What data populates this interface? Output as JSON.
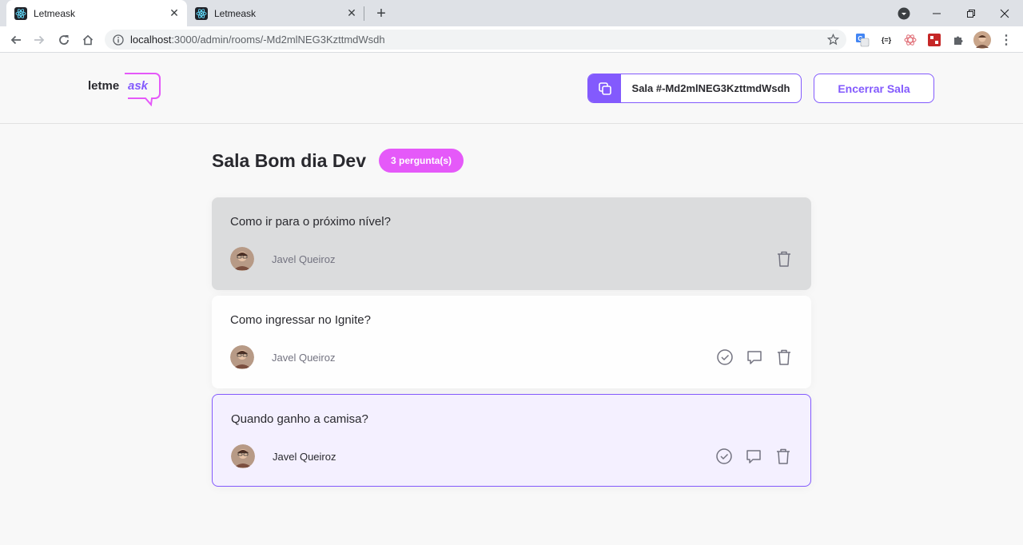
{
  "browser": {
    "tabs": [
      {
        "title": "Letmeask",
        "active": true
      },
      {
        "title": "Letmeask",
        "active": false
      }
    ],
    "url_host": "localhost",
    "url_rest": ":3000/admin/rooms/-Md2mlNEG3KzttmdWsdh"
  },
  "header": {
    "logo_text_primary": "letme",
    "logo_text_accent": "ask",
    "room_code_label": "Sala #-Md2mlNEG3KzttmdWsdh",
    "close_room_label": "Encerrar Sala"
  },
  "room": {
    "title": "Sala Bom dia Dev",
    "question_count": "3 pergunta(s)"
  },
  "questions": [
    {
      "text": "Como ir para o próximo nível?",
      "author": "Javel Queiroz",
      "state": "answered"
    },
    {
      "text": "Como ingressar no Ignite?",
      "author": "Javel Queiroz",
      "state": "default"
    },
    {
      "text": "Quando ganho a camisa?",
      "author": "Javel Queiroz",
      "state": "highlighted"
    }
  ],
  "colors": {
    "brand_purple": "#835afd",
    "badge_pink": "#e559f9",
    "answered_bg": "#dbdcdd",
    "highlight_bg": "#f4f0ff"
  }
}
